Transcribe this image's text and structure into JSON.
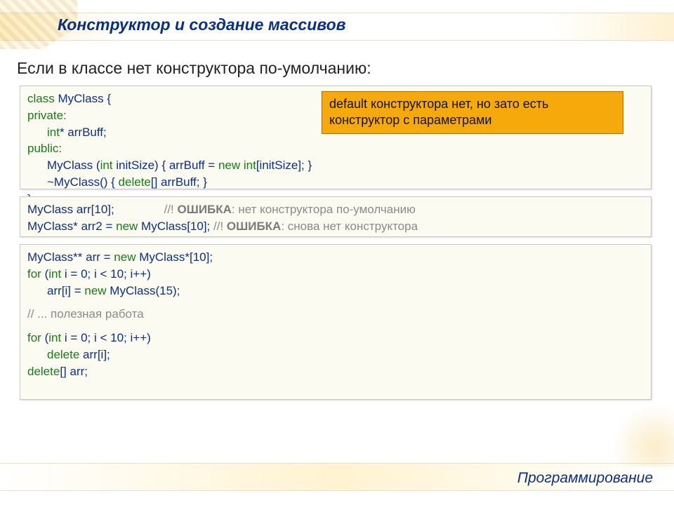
{
  "title": "Конструктор и создание массивов",
  "subtitle": "Если в классе нет конструктора по-умолчанию:",
  "callout": "default конструктора нет, но зато есть конструктор с параметрами",
  "footer": "Программирование",
  "code1": {
    "l1": {
      "a": "class",
      "b": " MyClass {"
    },
    "l2": {
      "a": "private",
      "b": ":"
    },
    "l3": {
      "a": "int",
      "b": "* arrBuff;"
    },
    "l4": {
      "a": "public",
      "b": ":"
    },
    "l5": {
      "a": "MyClass (",
      "b": "int",
      "c": " initSize) { arrBuff = ",
      "d": "new int",
      "e": "[initSize]; }"
    },
    "l6": {
      "a": "~MyClass() { ",
      "b": "delete",
      "c": "[] arrBuff; }"
    },
    "l7": "};"
  },
  "code2": {
    "l1": {
      "a": "MyClass arr[10];",
      "pad": "               ",
      "b": "//! ",
      "c": "ОШИБКА",
      "d": ": нет конструктора по-умолчанию"
    },
    "l2": {
      "a": "MyClass* arr2 = ",
      "b": "new",
      "c": " MyClass[10]; ",
      "d": "//! ",
      "e": "ОШИБКА",
      "f": ": снова нет конструктора"
    }
  },
  "code3": {
    "l1": {
      "a": "MyClass** arr = ",
      "b": "new",
      "c": " MyClass*[10];"
    },
    "l2": {
      "a": "for",
      "b": " (",
      "c": "int",
      "d": " i = 0; i < 10; i++)"
    },
    "l3": {
      "a": "arr[i] = ",
      "b": "new",
      "c": " MyClass(15);"
    },
    "l4": "// ... полезная работа",
    "l5": {
      "a": "for",
      "b": " (",
      "c": "int",
      "d": " i = 0; i < 10; i++)"
    },
    "l6": {
      "a": "delete",
      "b": " arr[i];"
    },
    "l7": {
      "a": "delete",
      "b": "[] arr;"
    }
  }
}
